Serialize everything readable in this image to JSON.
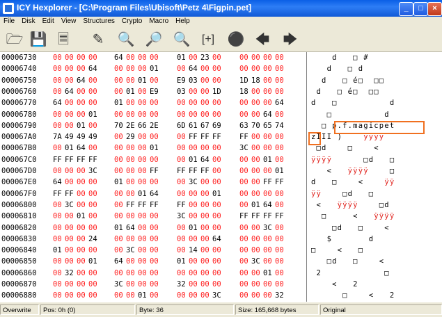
{
  "window": {
    "title": "ICY Hexplorer - [C:\\Program Files\\Ubisoft\\Petz 4\\Figpin.pet]",
    "controls": [
      "_",
      "□",
      "×"
    ]
  },
  "menu": [
    "File",
    "Disk",
    "Edit",
    "View",
    "Structures",
    "Crypto",
    "Macro",
    "Help"
  ],
  "toolbar": [
    "open-folder-icon",
    "save-disk-icon",
    "copy-pages-icon",
    "edit-document-icon",
    "find-icon",
    "find-replace-icon",
    "find-next-icon",
    "goto-offset-icon",
    "record-icon",
    "back-arrow-icon",
    "forward-arrow-icon"
  ],
  "rows": [
    {
      "addr": "00006730",
      "bytes": [
        "00",
        "00",
        "00",
        "00",
        "64",
        "00",
        "00",
        "00",
        "01",
        "00",
        "23",
        "00",
        "00",
        "00",
        "00",
        "00"
      ],
      "text": "    d   □ #     "
    },
    {
      "addr": "00006740",
      "bytes": [
        "00",
        "00",
        "00",
        "64",
        "00",
        "00",
        "00",
        "01",
        "00",
        "64",
        "00",
        "00",
        "00",
        "00",
        "00",
        "00"
      ],
      "text": "   d   □ d      "
    },
    {
      "addr": "00006750",
      "bytes": [
        "00",
        "00",
        "64",
        "00",
        "00",
        "00",
        "01",
        "00",
        "E9",
        "03",
        "00",
        "00",
        "1D",
        "18",
        "00",
        "00"
      ],
      "text": "  d   □ é□  □□  "
    },
    {
      "addr": "00006760",
      "bytes": [
        "00",
        "64",
        "00",
        "00",
        "00",
        "01",
        "00",
        "E9",
        "03",
        "00",
        "00",
        "1D",
        "18",
        "00",
        "00",
        "00"
      ],
      "text": " d   □ é□  □□   "
    },
    {
      "addr": "00006770",
      "bytes": [
        "64",
        "00",
        "00",
        "00",
        "01",
        "00",
        "00",
        "00",
        "00",
        "00",
        "00",
        "00",
        "00",
        "00",
        "00",
        "64"
      ],
      "text": "d   □          d"
    },
    {
      "addr": "00006780",
      "bytes": [
        "00",
        "00",
        "00",
        "01",
        "00",
        "00",
        "00",
        "00",
        "00",
        "00",
        "00",
        "00",
        "00",
        "00",
        "64",
        "00"
      ],
      "text": "   □          d "
    },
    {
      "addr": "00006790",
      "bytes": [
        "00",
        "00",
        "01",
        "00",
        "70",
        "2E",
        "66",
        "2E",
        "6D",
        "61",
        "67",
        "69",
        "63",
        "70",
        "65",
        "74"
      ],
      "text": "  □ p.f.magicpet"
    },
    {
      "addr": "000067A0",
      "bytes": [
        "7A",
        "49",
        "49",
        "49",
        "00",
        "29",
        "00",
        "00",
        "00",
        "FF",
        "FF",
        "FF",
        "FF",
        "00",
        "00",
        "00"
      ],
      "text": "zIII ) ",
      "red": "   ÿÿÿÿ   "
    },
    {
      "addr": "000067B0",
      "bytes": [
        "00",
        "01",
        "64",
        "00",
        "00",
        "00",
        "00",
        "01",
        "00",
        "00",
        "00",
        "00",
        "3C",
        "00",
        "00",
        "00"
      ],
      "text": " □d    □    <   "
    },
    {
      "addr": "000067C0",
      "bytes": [
        "FF",
        "FF",
        "FF",
        "FF",
        "00",
        "00",
        "00",
        "00",
        "00",
        "01",
        "64",
        "00",
        "00",
        "00",
        "01",
        "00"
      ],
      "text": "",
      "red": "ÿÿÿÿ",
      "tail": "      □d   □ "
    },
    {
      "addr": "000067D0",
      "bytes": [
        "00",
        "00",
        "00",
        "3C",
        "00",
        "00",
        "00",
        "FF",
        "FF",
        "FF",
        "FF",
        "00",
        "00",
        "00",
        "00",
        "01"
      ],
      "text": "   <   ",
      "red": "ÿÿÿÿ",
      "tail": "    □"
    },
    {
      "addr": "000067E0",
      "bytes": [
        "64",
        "00",
        "00",
        "00",
        "01",
        "00",
        "00",
        "00",
        "00",
        "3C",
        "00",
        "00",
        "00",
        "00",
        "FF",
        "FF"
      ],
      "text": "d   □    <    ",
      "red": "ÿÿ"
    },
    {
      "addr": "000067F0",
      "bytes": [
        "FF",
        "FF",
        "00",
        "00",
        "00",
        "00",
        "01",
        "64",
        "00",
        "00",
        "00",
        "01",
        "00",
        "00",
        "00",
        "00"
      ],
      "text": "",
      "red": "ÿÿ",
      "tail": "    □d   □    "
    },
    {
      "addr": "00006800",
      "bytes": [
        "00",
        "3C",
        "00",
        "00",
        "00",
        "FF",
        "FF",
        "FF",
        "FF",
        "00",
        "00",
        "00",
        "00",
        "01",
        "64",
        "00"
      ],
      "text": " <   ",
      "red": "ÿÿÿÿ",
      "tail": "    □d "
    },
    {
      "addr": "00006810",
      "bytes": [
        "00",
        "00",
        "01",
        "00",
        "00",
        "00",
        "00",
        "00",
        "3C",
        "00",
        "00",
        "00",
        "FF",
        "FF",
        "FF",
        "FF"
      ],
      "text": "  □     <   ",
      "red": "ÿÿÿÿ"
    },
    {
      "addr": "00006820",
      "bytes": [
        "00",
        "00",
        "00",
        "00",
        "01",
        "64",
        "00",
        "00",
        "00",
        "01",
        "00",
        "00",
        "00",
        "00",
        "3C",
        "00"
      ],
      "text": "    □d   □    < "
    },
    {
      "addr": "00006830",
      "bytes": [
        "00",
        "00",
        "00",
        "24",
        "00",
        "00",
        "00",
        "00",
        "00",
        "00",
        "00",
        "64",
        "00",
        "00",
        "00",
        "00"
      ],
      "text": "   $       d    "
    },
    {
      "addr": "00006840",
      "bytes": [
        "01",
        "00",
        "00",
        "00",
        "00",
        "3C",
        "00",
        "00",
        "00",
        "14",
        "00",
        "00",
        "00",
        "00",
        "00",
        "00"
      ],
      "text": "□    <   □      "
    },
    {
      "addr": "00006850",
      "bytes": [
        "00",
        "00",
        "00",
        "01",
        "64",
        "00",
        "00",
        "00",
        "01",
        "00",
        "00",
        "00",
        "00",
        "3C",
        "00",
        "00"
      ],
      "text": "   □d   □    <  "
    },
    {
      "addr": "00006860",
      "bytes": [
        "00",
        "32",
        "00",
        "00",
        "00",
        "00",
        "00",
        "00",
        "00",
        "00",
        "00",
        "00",
        "00",
        "00",
        "01",
        "00"
      ],
      "text": " 2            □ "
    },
    {
      "addr": "00006870",
      "bytes": [
        "00",
        "00",
        "00",
        "00",
        "3C",
        "00",
        "00",
        "00",
        "32",
        "00",
        "00",
        "00",
        "00",
        "00",
        "00",
        "00"
      ],
      "text": "    <   2       "
    },
    {
      "addr": "00006880",
      "bytes": [
        "00",
        "00",
        "00",
        "00",
        "00",
        "00",
        "01",
        "00",
        "00",
        "00",
        "00",
        "3C",
        "00",
        "00",
        "00",
        "32"
      ],
      "text": "      □    <   2"
    }
  ],
  "status": {
    "mode": "Overwrite",
    "pos": "Pos: 0h (0)",
    "byte": "Byte: 36",
    "size": "Size: 165,668 bytes",
    "state": "Original"
  }
}
